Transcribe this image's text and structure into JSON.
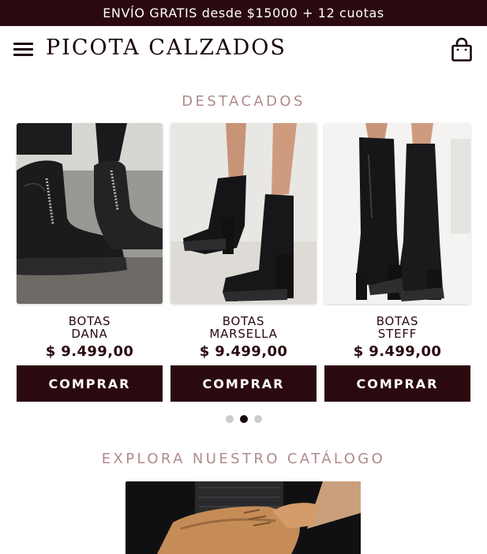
{
  "promo_bar": {
    "text": "ENVÍO GRATIS desde $15000 + 12 cuotas"
  },
  "header": {
    "brand": "PICOTA CALZADOS",
    "menu_icon": "hamburger-menu-icon",
    "cart_icon": "shopping-bag-icon"
  },
  "featured": {
    "title": "DESTACADOS",
    "products": [
      {
        "line1": "BOTAS",
        "line2": "DANA",
        "price": "$ 9.499,00",
        "button": "COMPRAR"
      },
      {
        "line1": "BOTAS",
        "line2": "MARSELLA",
        "price": "$ 9.499,00",
        "button": "COMPRAR"
      },
      {
        "line1": "BOTAS",
        "line2": "STEFF",
        "price": "$ 9.499,00",
        "button": "COMPRAR"
      }
    ],
    "carousel": {
      "pages": 3,
      "active_page": 2
    }
  },
  "catalog": {
    "title": "EXPLORA NUESTRO CATÁLOGO"
  },
  "colors": {
    "brand_dark": "#2b0a0f",
    "section_title": "#b08a8c",
    "dot_inactive": "#cccccc"
  }
}
